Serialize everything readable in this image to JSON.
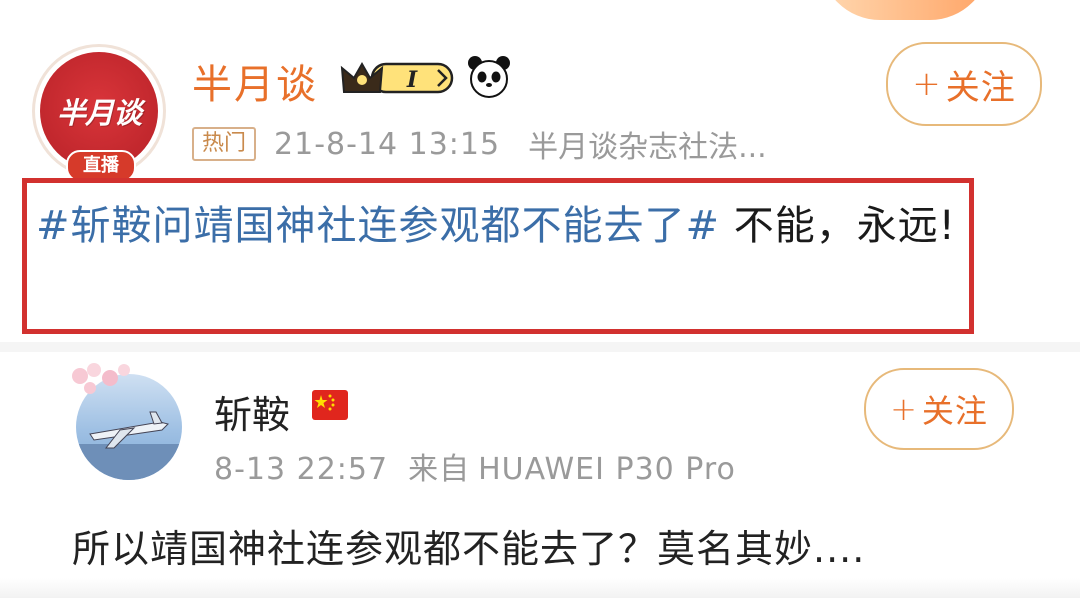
{
  "post": {
    "avatar_text": "半月谈",
    "live_badge": "直播",
    "username": "半月谈",
    "badge_level": "I",
    "follow_label": "关注",
    "hot_tag": "热门",
    "timestamp": "21-8-14 13:15",
    "source": "半月谈杂志社法...",
    "hashtag": "#斩鞍问靖国神社连参观都不能去了#",
    "body": " 不能，永远!"
  },
  "comment": {
    "username": "斩鞍",
    "follow_label": "关注",
    "timestamp": "8-13 22:57",
    "source_prefix": "来自",
    "device": "HUAWEI P30 Pro",
    "text": "所以靖国神社连参观都不能去了？莫名其妙...."
  },
  "colors": {
    "accent": "#e8702a",
    "highlight_border": "#d2312f",
    "hashtag": "#3b6ea8"
  }
}
